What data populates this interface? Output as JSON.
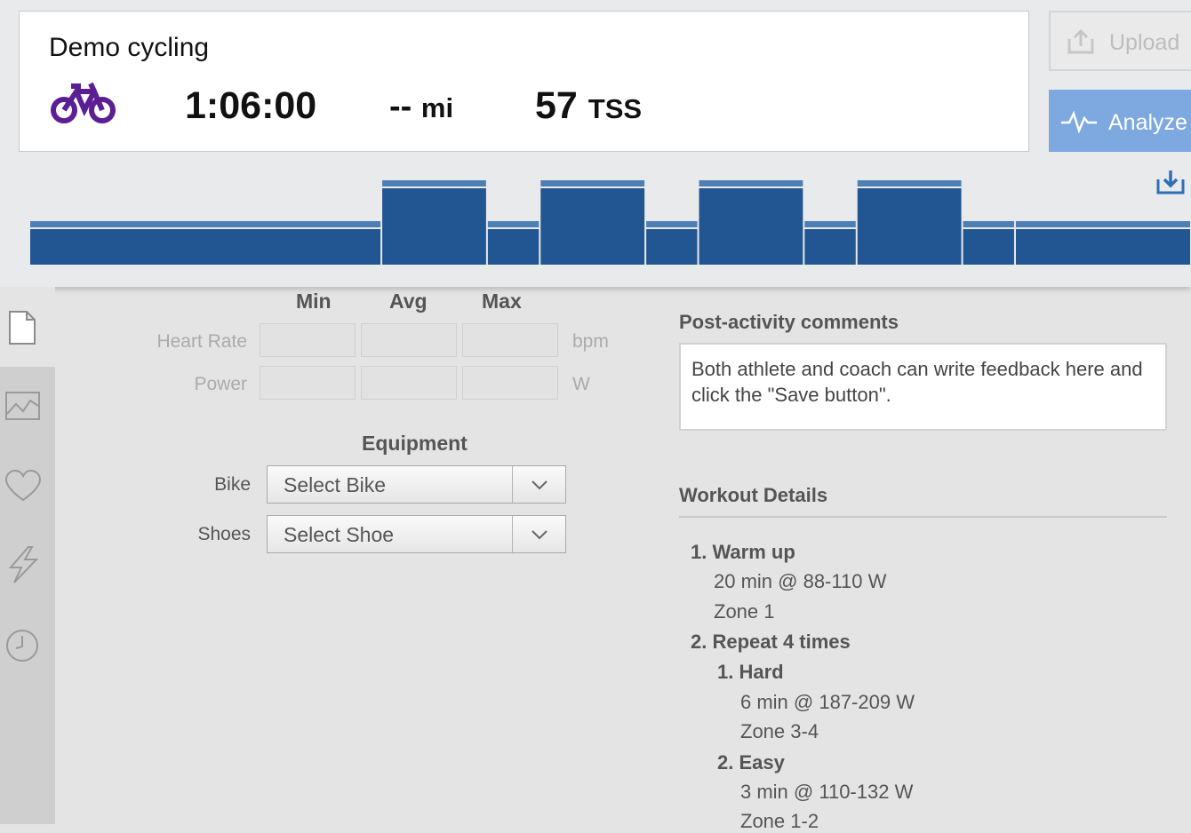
{
  "activity": {
    "title": "Demo cycling",
    "sport_icon": "bike-icon",
    "duration": "1:06:00",
    "distance_value": "--",
    "distance_unit": "mi",
    "tss_value": "57",
    "tss_unit": "TSS"
  },
  "actions": {
    "upload_label": "Upload",
    "analyze_label": "Analyze",
    "download_icon": "download-icon"
  },
  "colors": {
    "accent": "#7ea8e0",
    "bar_fill": "#225692",
    "bar_top": "#4d7fb4",
    "sport_purple": "#5b1f93"
  },
  "chart_data": {
    "type": "bar",
    "description_free": true,
    "segments": [
      {
        "duration_min": 20,
        "level": "low"
      },
      {
        "duration_min": 6,
        "level": "high"
      },
      {
        "duration_min": 3,
        "level": "low"
      },
      {
        "duration_min": 6,
        "level": "high"
      },
      {
        "duration_min": 3,
        "level": "low"
      },
      {
        "duration_min": 6,
        "level": "high"
      },
      {
        "duration_min": 3,
        "level": "low"
      },
      {
        "duration_min": 6,
        "level": "high"
      },
      {
        "duration_min": 3,
        "level": "low"
      },
      {
        "duration_min": 10,
        "level": "low"
      }
    ],
    "low_range_w": [
      88,
      110
    ],
    "high_range_w": [
      187,
      209
    ],
    "easy_range_w": [
      110,
      132
    ]
  },
  "sidebar": {
    "icons": [
      "document-icon",
      "chart-icon",
      "heart-icon",
      "lightning-icon",
      "clock-icon"
    ]
  },
  "metrics": {
    "columns": [
      "Min",
      "Avg",
      "Max"
    ],
    "rows": [
      {
        "label": "Heart Rate",
        "unit": "bpm"
      },
      {
        "label": "Power",
        "unit": "W"
      }
    ]
  },
  "equipment": {
    "title": "Equipment",
    "bike_label": "Bike",
    "bike_value": "Select Bike",
    "shoes_label": "Shoes",
    "shoes_value": "Select Shoe"
  },
  "comments": {
    "title": "Post-activity comments",
    "placeholder": "Both athlete and coach can write feedback here and click the \"Save button\"."
  },
  "workout": {
    "title": "Workout Details",
    "lines": [
      {
        "num": "1.",
        "text": "Warm up",
        "bold": true
      },
      {
        "text": "20 min @ 88-110 W"
      },
      {
        "text": "Zone 1"
      },
      {
        "num": "2.",
        "text": "Repeat 4 times",
        "bold": true
      },
      {
        "num": "1.",
        "text": "Hard",
        "bold": true
      },
      {
        "text": "6 min @ 187-209 W"
      },
      {
        "text": "Zone 3-4"
      },
      {
        "num": "2.",
        "text": "Easy",
        "bold": true
      },
      {
        "text": "3 min @ 110-132 W"
      },
      {
        "text": "Zone 1-2"
      }
    ]
  }
}
